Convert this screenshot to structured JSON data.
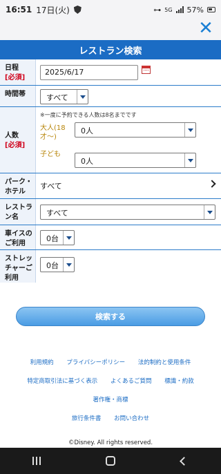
{
  "status_bar": {
    "time": "16:51",
    "date": "17日(火)",
    "battery": "57%",
    "network": "5G"
  },
  "header": {
    "title": "レストラン検索",
    "close": "✕"
  },
  "form": {
    "date": {
      "label": "日程",
      "required": "[必須]",
      "value": "2025/6/17"
    },
    "time_slot": {
      "label": "時間帯",
      "value": "すべて"
    },
    "people": {
      "label": "人数",
      "required": "[必須]",
      "note": "※一度に予約できる人数は8名までです",
      "adult_label": "大人(18才〜)",
      "adult_value": "0人",
      "child_label": "子ども",
      "child_value": "0人"
    },
    "park_hotel": {
      "label": "パーク・ホテル",
      "value": "すべて"
    },
    "restaurant": {
      "label": "レストラン名",
      "value": "すべて"
    },
    "wheelchair": {
      "label": "車イスのご利用",
      "value": "0台"
    },
    "stretcher": {
      "label": "ストレッチャーご利用",
      "value": "0台"
    }
  },
  "search_button": "検索する",
  "footer_links": {
    "row1": [
      "利用規約",
      "プライバシーポリシー",
      "法的制約と使用条件"
    ],
    "row2": [
      "特定商取引法に基づく表示",
      "よくあるご質問",
      "標識・約款"
    ],
    "row3": [
      "著作権・商標"
    ],
    "row4": [
      "旅行条件書",
      "お問い合わせ"
    ]
  },
  "copyright": "©Disney. All rights reserved."
}
